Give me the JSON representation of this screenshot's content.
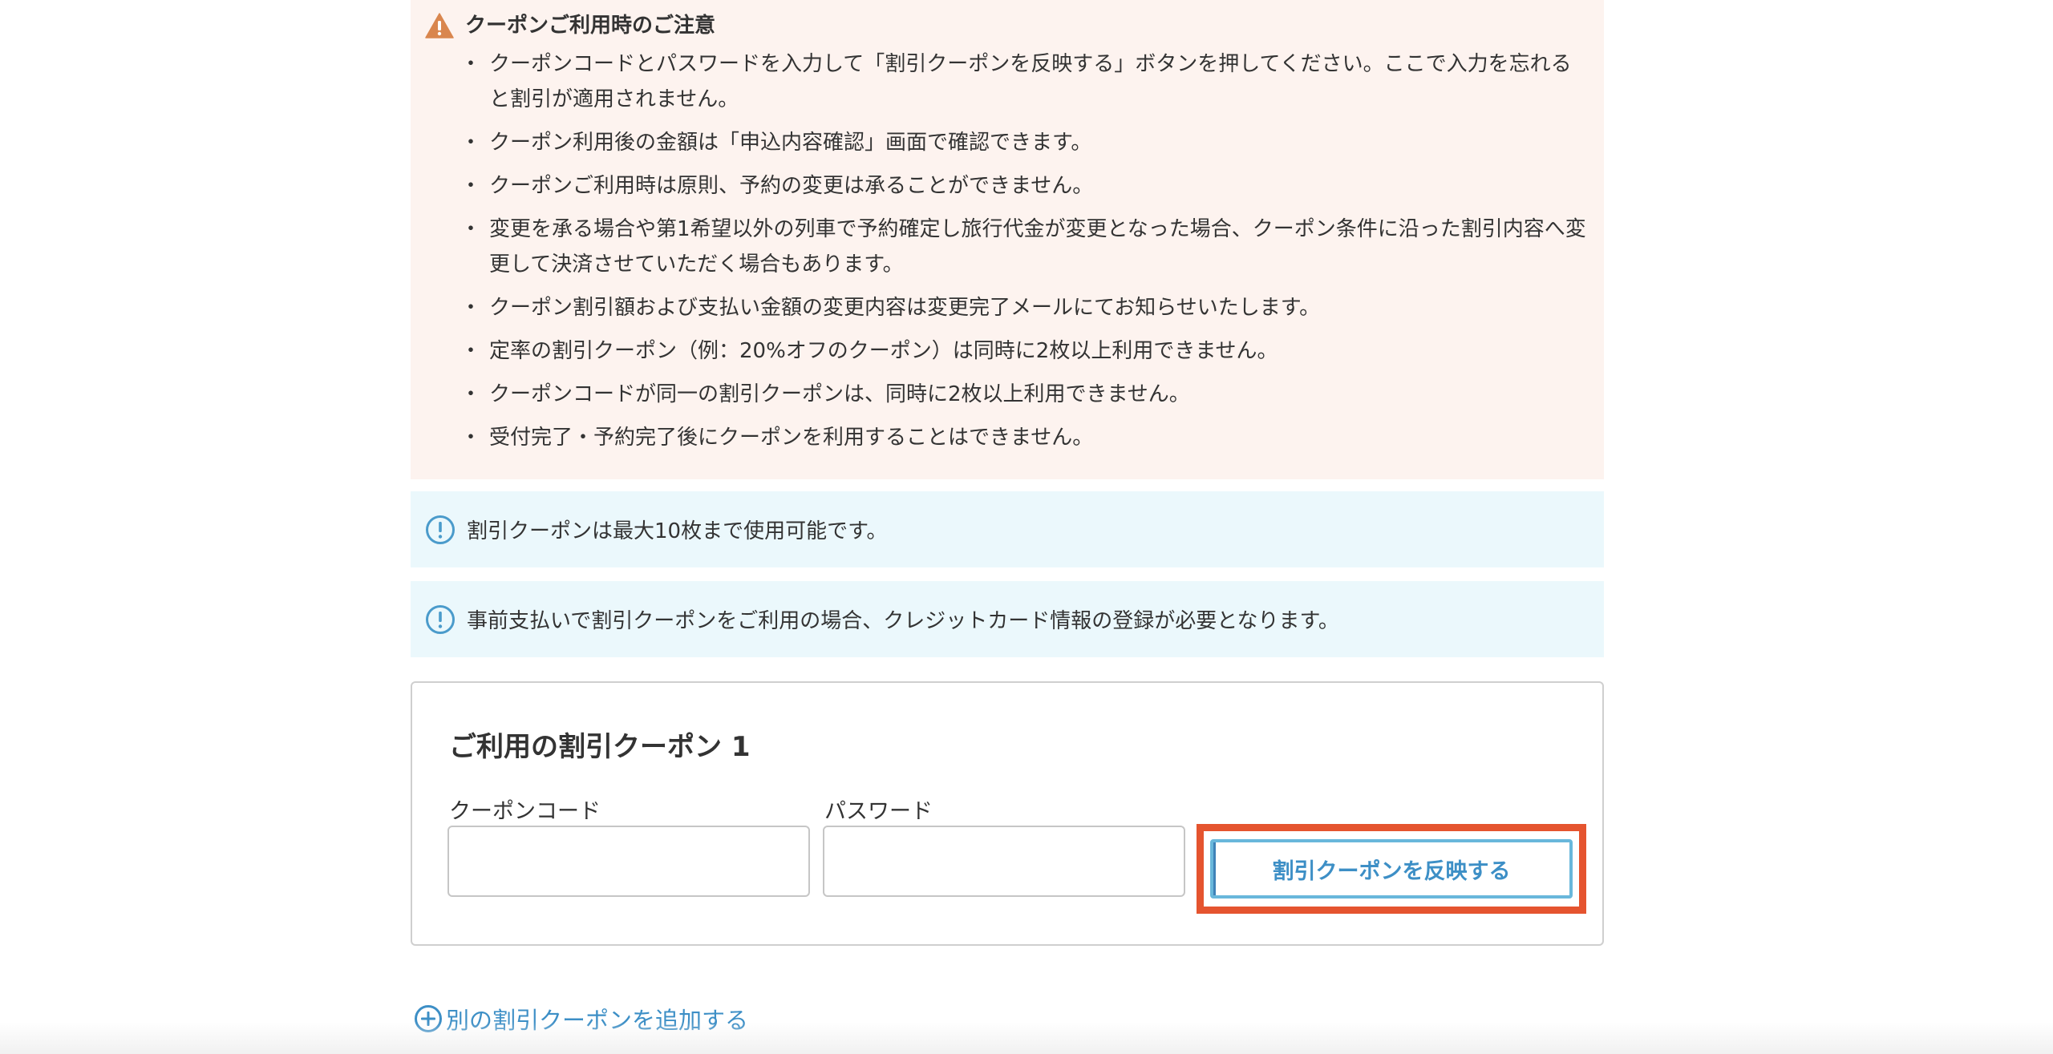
{
  "caution": {
    "title": "クーポンご利用時のご注意",
    "items": [
      "クーポンコードとパスワードを入力して「割引クーポンを反映する」ボタンを押してください。ここで入力を忘れると割引が適用されません。",
      "クーポン利用後の金額は「申込内容確認」画面で確認できます。",
      "クーポンご利用時は原則、予約の変更は承ることができません。",
      "変更を承る場合や第1希望以外の列車で予約確定し旅行代金が変更となった場合、クーポン条件に沿った割引内容へ変更して決済させていただく場合もあります。",
      "クーポン割引額および支払い金額の変更内容は変更完了メールにてお知らせいたします。",
      "定率の割引クーポン（例：20%オフのクーポン）は同時に2枚以上利用できません。",
      "クーポンコードが同一の割引クーポンは、同時に2枚以上利用できません。",
      "受付完了・予約完了後にクーポンを利用することはできません。"
    ]
  },
  "info": {
    "max_coupons": "割引クーポンは最大10枚まで使用可能です。",
    "credit_card_notice": "事前支払いで割引クーポンをご利用の場合、クレジットカード情報の登録が必要となります。"
  },
  "coupon_form": {
    "heading": "ご利用の割引クーポン 1",
    "code_label": "クーポンコード",
    "code_value": "",
    "password_label": "パスワード",
    "password_value": "",
    "apply_label": "割引クーポンを反映する"
  },
  "add_coupon_label": "別の割引クーポンを追加する",
  "colors": {
    "caution_bg": "#fdf3ef",
    "info_bg": "#ebf8fc",
    "accent_blue": "#3d8fc6",
    "highlight_red": "#e5542f",
    "warning_orange": "#d9864e"
  }
}
